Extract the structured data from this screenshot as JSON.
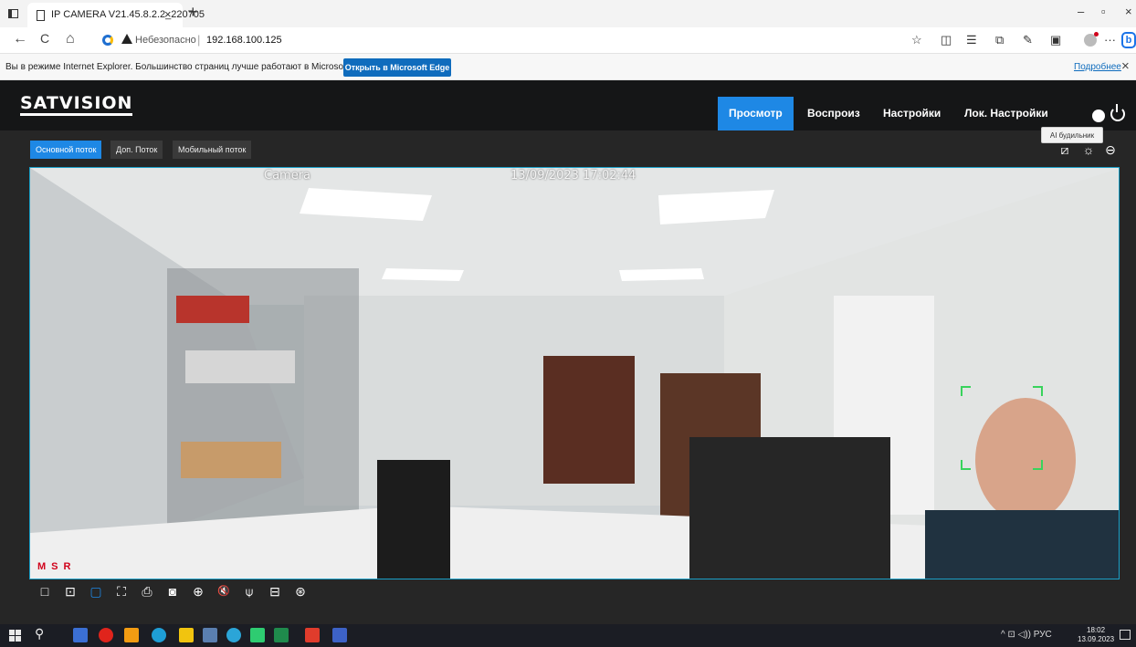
{
  "browser": {
    "tab_title": "IP CAMERA V21.45.8.2.2_220705",
    "tab_close": "×",
    "new_tab": "+",
    "window_controls": [
      "–",
      "▫",
      "×"
    ],
    "nav_back": "←",
    "nav_refresh": "C",
    "nav_home": "⌂",
    "security_label": "Небезопасно",
    "url_separator": "|",
    "url": "192.168.100.125",
    "toolbar_icons": [
      "star-icon",
      "reading-view-icon",
      "favorites-icon",
      "collections-icon",
      "extensions-icon",
      "screenshot-icon",
      "profile-icon",
      "more-icon",
      "bing-icon"
    ],
    "more": "···",
    "bing_letter": "b"
  },
  "ie_banner": {
    "message": "Вы в режиме Internet Explorer. Большинство страниц лучше работают в Microsoft Edge.",
    "open_button": "Открыть в Microsoft Edge",
    "more_link": "Подробнее",
    "close": "×"
  },
  "app": {
    "logo": "SATVISION",
    "nav": {
      "view": "Просмотр",
      "playback": "Воспроиз",
      "settings": "Настройки",
      "local_settings": "Лок. Настройки"
    },
    "tooltip": "AI будильник",
    "streams": {
      "main": "Основной поток",
      "sub": "Доп. Поток",
      "mobile": "Мобильный поток"
    },
    "view_tools": [
      "image-adjust-icon",
      "brightness-icon",
      "ptz-icon"
    ],
    "osd": {
      "name": "Camera",
      "datetime": "13/09/2023 17:02:44",
      "status": "MSR"
    },
    "controls": [
      "window-1x1-icon",
      "window-fit-icon",
      "window-fill-icon",
      "fullscreen-icon",
      "record-icon",
      "snapshot-icon",
      "zoom-in-icon",
      "mute-icon",
      "microphone-icon",
      "face-detect-icon",
      "talk-icon"
    ],
    "control_glyphs": [
      "□",
      "⊡",
      "▢",
      "⛶",
      "⎙",
      "◙",
      "⊕",
      "🔇",
      "⍦",
      "⊟",
      "⊛"
    ]
  },
  "taskbar": {
    "tray_text": "^ ⊡ ◁)) РУС",
    "time": "18:02",
    "date": "13.09.2023",
    "search_glyph": "⚲"
  },
  "colors": {
    "accent": "#1e88e5",
    "app_bg": "#262626",
    "header_bg": "#151617",
    "video_border": "#1aa0c8",
    "status_red": "#d0021b"
  }
}
